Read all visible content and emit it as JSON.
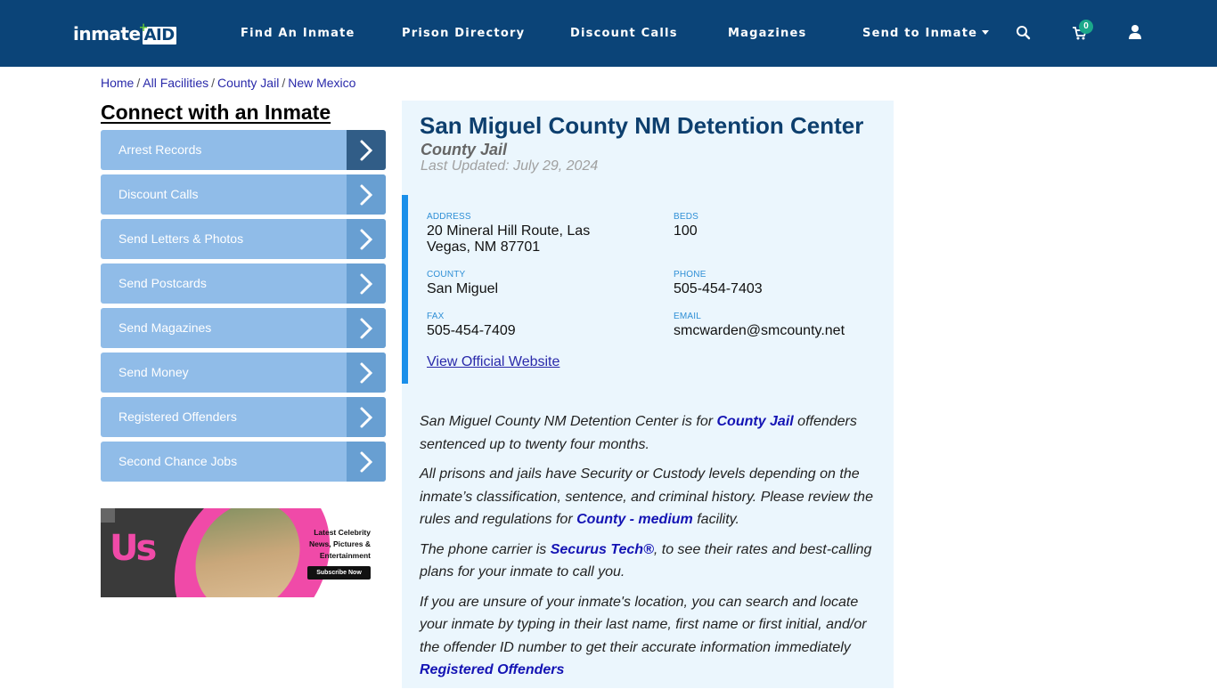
{
  "nav": {
    "logo_main": "inmate",
    "logo_accent": "AID",
    "items": [
      {
        "label": "Find An Inmate"
      },
      {
        "label": "Prison Directory"
      },
      {
        "label": "Discount Calls"
      },
      {
        "label": "Magazines"
      },
      {
        "label": "Send to Inmate"
      }
    ],
    "cart_count": "0",
    "icons": [
      "search-icon",
      "cart-icon",
      "user-icon"
    ]
  },
  "breadcrumb": [
    {
      "label": "Home"
    },
    {
      "label": "All Facilities"
    },
    {
      "label": "County Jail"
    },
    {
      "label": "New Mexico"
    }
  ],
  "sidebar": {
    "title": "Connect with an Inmate",
    "items": [
      {
        "label": "Arrest Records"
      },
      {
        "label": "Discount Calls"
      },
      {
        "label": "Send Letters & Photos"
      },
      {
        "label": "Send Postcards"
      },
      {
        "label": "Send Magazines"
      },
      {
        "label": "Send Money"
      },
      {
        "label": "Registered Offenders"
      },
      {
        "label": "Second Chance Jobs"
      }
    ]
  },
  "ad": {
    "brand": "Us",
    "tagline_1": "Latest Celebrity",
    "tagline_2": "News, Pictures &",
    "tagline_3": "Entertainment",
    "button": "Subscribe Now"
  },
  "facility": {
    "name": "San Miguel County NM Detention Center",
    "type": "County Jail",
    "last_updated": "Last Updated: July 29, 2024",
    "fields": {
      "address": {
        "label": "ADDRESS",
        "value_1": "20 Mineral Hill Route, Las",
        "value_2": "Vegas, NM 87701"
      },
      "beds": {
        "label": "BEDS",
        "value": "100"
      },
      "county": {
        "label": "COUNTY",
        "value": "San Miguel"
      },
      "phone": {
        "label": "PHONE",
        "value": "505-454-7403"
      },
      "fax": {
        "label": "FAX",
        "value": "505-454-7409"
      },
      "email": {
        "label": "EMAIL",
        "value": "smcwarden@smcounty.net"
      }
    },
    "website_link": "View Official Website"
  },
  "description": {
    "p1_a": "San Miguel County NM Detention Center is for ",
    "p1_link": "County Jail",
    "p1_b": " offenders sentenced up to twenty four months.",
    "p2_a": "All prisons and jails have Security or Custody levels depending on the inmate’s classification, sentence, and criminal history. Please review the rules and regulations for ",
    "p2_link": "County - medium",
    "p2_b": " facility.",
    "p3_a": "The phone carrier is ",
    "p3_link": "Securus Tech®",
    "p3_b": ", to see their rates and best-calling plans for your inmate to call you.",
    "p4_a": "If you are unsure of your inmate's location, you can search and locate your inmate by typing in their last name, first name or first initial, and/or the offender ID number to get their accurate information immediately",
    "p4_link": "Registered Offenders"
  }
}
